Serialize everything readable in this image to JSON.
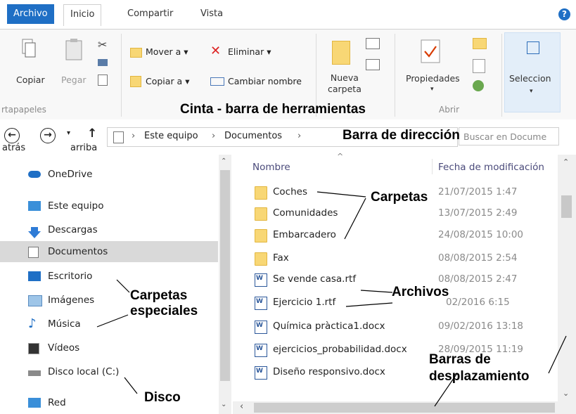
{
  "ribbon": {
    "tabs": [
      "Archivo",
      "Inicio",
      "Compartir",
      "Vista"
    ],
    "help": "?",
    "clipboard": {
      "copy": "Copiar",
      "paste": "Pegar",
      "group": "rtapapeles"
    },
    "organize": {
      "move": "Mover a ▾",
      "copy_to": "Copiar a ▾",
      "delete": "Eliminar ▾",
      "rename": "Cambiar nombre"
    },
    "new": {
      "new_folder_l1": "Nueva",
      "new_folder_l2": "carpeta"
    },
    "open": {
      "properties": "Propiedades",
      "group": "Abrir"
    },
    "select": {
      "label": "Seleccion"
    }
  },
  "address": {
    "back": "←",
    "forward": "→",
    "up": "↑",
    "back_label": "atrás",
    "up_label": "arriba",
    "crumb_1": "Este equipo",
    "crumb_2": "Documentos",
    "search_placeholder": "Buscar en Docume"
  },
  "nav": {
    "items": [
      "OneDrive",
      "Este equipo",
      "Descargas",
      "Documentos",
      "Escritorio",
      "Imágenes",
      "Música",
      "Vídeos",
      "Disco local (C:)",
      "Red"
    ]
  },
  "files": {
    "col_name": "Nombre",
    "col_date": "Fecha de modificación",
    "rows": [
      {
        "name": "Coches",
        "date": "21/07/2015 1:47"
      },
      {
        "name": "Comunidades",
        "date": "13/07/2015 2:49"
      },
      {
        "name": "Embarcadero",
        "date": "24/08/2015 10:00"
      },
      {
        "name": "Fax",
        "date": "08/08/2015 2:54"
      },
      {
        "name": "Se vende casa.rtf",
        "date": "08/08/2015 2:47"
      },
      {
        "name": "Ejercicio 1.rtf",
        "date": "02/2016 6:15"
      },
      {
        "name": "Química pràctica1.docx",
        "date": "09/02/2016 13:18"
      },
      {
        "name": "ejercicios_probabilidad.docx",
        "date": "28/09/2015 11:19"
      },
      {
        "name": "Diseño responsivo.docx",
        "date": ""
      }
    ]
  },
  "annotations": {
    "ribbon": "Cinta - barra de herramientas",
    "address": "Barra de dirección",
    "folders": "Carpetas",
    "files": "Archivos",
    "special_l1": "Carpetas",
    "special_l2": "especiales",
    "disk": "Disco",
    "scroll_l1": "Barras de",
    "scroll_l2": "desplazamiento"
  },
  "colors": {
    "accent": "#1f6fc5",
    "selected": "#d9d9d9",
    "folder": "#f8d775"
  }
}
